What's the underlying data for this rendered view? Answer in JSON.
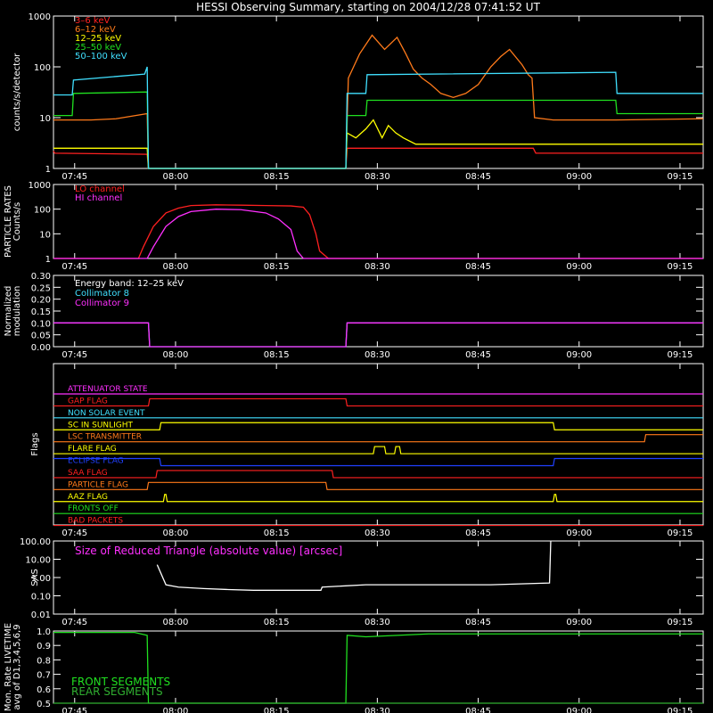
{
  "title": "HESSI Observing Summary, starting on 2004/12/28 07:41:52 UT",
  "x_ticks": [
    "07:45",
    "08:00",
    "08:15",
    "08:30",
    "08:45",
    "09:00",
    "09:15"
  ],
  "colors": {
    "red": "#ff2020",
    "orange": "#ff7a1a",
    "yellow": "#ffff00",
    "green": "#20e020",
    "cyan": "#40e0ff",
    "magenta": "#ff30ff",
    "crimson": "#e01040",
    "blue": "#2040ff",
    "white": "#ffffff",
    "darkgreen": "#30b030"
  },
  "chart_data": [
    {
      "id": "lightcurves",
      "type": "line",
      "title": "HESSI Observing Summary, starting on 2004/12/28 07:41:52 UT",
      "ylabel": "counts/s/detector",
      "yscale": "log",
      "ylim": [
        1,
        1000
      ],
      "y_ticks": [
        "1",
        "10",
        "100",
        "1000"
      ],
      "x_range_minutes": [
        0,
        52
      ],
      "series": [
        {
          "name": "3–6 keV",
          "color": "red",
          "x": [
            0,
            0.1,
            7.5,
            7.6,
            23.4,
            23.5,
            38.4,
            38.6,
            52
          ],
          "y": [
            2.2,
            2.0,
            1.9,
            1.0,
            1.0,
            2.5,
            2.5,
            2.0,
            2.0
          ]
        },
        {
          "name": "6–12 keV",
          "color": "orange",
          "x": [
            0,
            1.2,
            3,
            5,
            7.5,
            7.6,
            23.4,
            23.6,
            24.5,
            25.5,
            26.5,
            27.5,
            28.2,
            28.8,
            29.5,
            30.2,
            31,
            32,
            33,
            34,
            35,
            35.8,
            36.5,
            37.5,
            38,
            38.3,
            38.5,
            40,
            45,
            52
          ],
          "y": [
            9,
            9,
            9,
            9.5,
            12,
            1.0,
            1.0,
            60,
            180,
            420,
            220,
            380,
            180,
            90,
            60,
            45,
            30,
            25,
            30,
            45,
            100,
            160,
            220,
            110,
            70,
            60,
            10,
            9,
            9,
            9.5
          ]
        },
        {
          "name": "12–25 keV",
          "color": "yellow",
          "x": [
            0,
            7.5,
            7.6,
            23.4,
            23.5,
            24.2,
            25,
            25.6,
            26.3,
            26.8,
            27.4,
            28,
            29,
            52
          ],
          "y": [
            2.5,
            2.5,
            1.0,
            1.0,
            5,
            4,
            6,
            9,
            4,
            7,
            5,
            4,
            3,
            3
          ]
        },
        {
          "name": "25–50 keV",
          "color": "green",
          "x": [
            0,
            1.5,
            1.6,
            7.5,
            7.6,
            23.4,
            23.5,
            25,
            25.1,
            45,
            45.1,
            52
          ],
          "y": [
            11,
            11,
            30,
            32,
            1.0,
            1.0,
            11,
            11,
            22,
            22,
            12,
            12
          ]
        },
        {
          "name": "50–100 keV",
          "color": "cyan",
          "x": [
            0,
            1.5,
            1.6,
            7.3,
            7.5,
            7.6,
            23.4,
            23.5,
            25,
            25.1,
            45,
            45.1,
            52
          ],
          "y": [
            28,
            28,
            55,
            72,
            100,
            1.0,
            1.0,
            30,
            30,
            70,
            78,
            30,
            30
          ]
        }
      ]
    },
    {
      "id": "particle",
      "type": "line",
      "ylabel": "PARTICLE RATES\nCounts/s",
      "yscale": "log",
      "ylim": [
        1,
        1000
      ],
      "y_ticks": [
        "1",
        "10",
        "100",
        "1000"
      ],
      "x_range_minutes": [
        0,
        52
      ],
      "series": [
        {
          "name": "LO channel",
          "color": "red",
          "x": [
            0,
            6.8,
            7.2,
            8,
            9,
            10,
            11,
            13,
            15,
            17,
            19,
            20,
            20.5,
            21,
            21.3,
            22,
            52
          ],
          "y": [
            1.0,
            1.0,
            3,
            20,
            70,
            110,
            140,
            150,
            145,
            140,
            135,
            120,
            60,
            10,
            2,
            1.0,
            1.0
          ]
        },
        {
          "name": "HI channel",
          "color": "magenta",
          "x": [
            0,
            7.5,
            8,
            9,
            10,
            11,
            13,
            15,
            17,
            18,
            19,
            19.5,
            20,
            52
          ],
          "y": [
            1.0,
            1.0,
            3,
            20,
            50,
            80,
            100,
            95,
            70,
            40,
            15,
            2,
            1.0,
            1.0
          ]
        }
      ]
    },
    {
      "id": "modulation",
      "type": "line",
      "ylabel": "Normalized\nmodulation",
      "ylim": [
        0,
        0.3
      ],
      "y_ticks": [
        "0.00",
        "0.05",
        "0.10",
        "0.15",
        "0.20",
        "0.25",
        "0.30"
      ],
      "x_range_minutes": [
        0,
        52
      ],
      "annotation": "Energy band: 12–25 keV",
      "series": [
        {
          "name": "Collimator 8",
          "color": "cyan",
          "x": [
            0,
            7.6,
            7.7,
            23.4,
            23.5,
            52
          ],
          "y": [
            0.1,
            0.1,
            0,
            0,
            0.1,
            0.1
          ]
        },
        {
          "name": "Collimator 9",
          "color": "magenta",
          "x": [
            0,
            7.6,
            7.7,
            23.4,
            23.5,
            52
          ],
          "y": [
            0.1,
            0.1,
            0,
            0,
            0.1,
            0.1
          ]
        }
      ]
    },
    {
      "id": "flags",
      "type": "line",
      "ylabel": "Flags",
      "x_range_minutes": [
        0,
        52
      ],
      "series": [
        {
          "name": "ATTENUATOR STATE",
          "color": "magenta",
          "x": [
            0,
            52
          ],
          "y": [
            0,
            0
          ]
        },
        {
          "name": "GAP FLAG",
          "color": "red",
          "x": [
            0,
            7.6,
            7.7,
            23.4,
            23.5,
            52
          ],
          "y": [
            0,
            0,
            1,
            1,
            0,
            0
          ]
        },
        {
          "name": "NON SOLAR EVENT",
          "color": "cyan",
          "x": [
            0,
            52
          ],
          "y": [
            0,
            0
          ]
        },
        {
          "name": "SC IN SUNLIGHT",
          "color": "yellow",
          "x": [
            0,
            8.5,
            8.6,
            40,
            40.1,
            52
          ],
          "y": [
            0,
            0,
            1,
            1,
            0,
            0
          ]
        },
        {
          "name": "LSC TRANSMITTER",
          "color": "orange",
          "x": [
            0,
            47.3,
            47.4,
            52
          ],
          "y": [
            0,
            0,
            1,
            1
          ]
        },
        {
          "name": "FLARE FLAG",
          "color": "yellow",
          "x": [
            0,
            25.6,
            25.7,
            26.5,
            26.6,
            27.3,
            27.4,
            27.7,
            27.8,
            52
          ],
          "y": [
            0,
            0,
            1,
            1,
            0,
            0,
            1,
            1,
            0,
            0
          ]
        },
        {
          "name": "ECLIPSE FLAG",
          "color": "blue",
          "x": [
            0,
            8.5,
            8.6,
            40,
            40.1,
            52
          ],
          "y": [
            1,
            1,
            0,
            0,
            1,
            1
          ]
        },
        {
          "name": "SAA FLAG",
          "color": "red",
          "x": [
            0,
            8.2,
            8.3,
            22.3,
            22.4,
            52
          ],
          "y": [
            0,
            0,
            1,
            1,
            0,
            0
          ]
        },
        {
          "name": "PARTICLE FLAG",
          "color": "orange",
          "x": [
            0,
            7.5,
            7.6,
            21.8,
            21.9,
            52
          ],
          "y": [
            0,
            0,
            1,
            1,
            0,
            0
          ]
        },
        {
          "name": "AAZ FLAG",
          "color": "yellow",
          "x": [
            0,
            8.8,
            8.9,
            9.0,
            9.1,
            40.0,
            40.1,
            40.2,
            40.3,
            52
          ],
          "y": [
            0,
            0,
            1,
            1,
            0,
            0,
            1,
            1,
            0,
            0
          ]
        },
        {
          "name": "FRONTS OFF",
          "color": "green",
          "x": [
            0,
            52
          ],
          "y": [
            0,
            0
          ]
        },
        {
          "name": "BAD PACKETS",
          "color": "red",
          "x": [
            0,
            52
          ],
          "y": [
            0,
            0
          ]
        }
      ]
    },
    {
      "id": "sas",
      "type": "line",
      "ylabel": "SAS",
      "yscale": "log",
      "ylim": [
        0.01,
        100
      ],
      "y_ticks": [
        "0.01",
        "0.10",
        "1.00",
        "10.00",
        "100.00"
      ],
      "x_range_minutes": [
        0,
        52
      ],
      "annotation": "Size of Reduced Triangle (absolute value) [arcsec]",
      "series": [
        {
          "name": "Size of Reduced Triangle (absolute value) [arcsec]",
          "color": "white",
          "x": [
            8.3,
            9,
            10,
            12,
            14,
            16,
            18,
            20,
            21.4,
            21.5,
            25,
            30,
            35,
            39.7,
            39.8
          ],
          "y": [
            5,
            0.4,
            0.3,
            0.25,
            0.22,
            0.2,
            0.2,
            0.2,
            0.2,
            0.3,
            0.4,
            0.4,
            0.4,
            0.5,
            100
          ]
        }
      ]
    },
    {
      "id": "livetime",
      "type": "line",
      "ylabel": "Mon. Rate LIVETIME\navg of D1,3,4,5,6,9",
      "ylim": [
        0.5,
        1.0
      ],
      "y_ticks": [
        "0.5",
        "0.6",
        "0.7",
        "0.8",
        "0.9",
        "1.0"
      ],
      "x_range_minutes": [
        0,
        52
      ],
      "series": [
        {
          "name": "FRONT SEGMENTS",
          "color": "green",
          "x": [
            0,
            6.5,
            7.5,
            7.6,
            23.4,
            23.5,
            25,
            30,
            52
          ],
          "y": [
            0.99,
            0.99,
            0.97,
            0.5,
            0.5,
            0.97,
            0.96,
            0.98,
            0.98
          ]
        },
        {
          "name": "REAR SEGMENTS",
          "color": "darkgreen",
          "x": [
            0,
            52
          ],
          "y": [
            0.5,
            0.5
          ]
        }
      ]
    }
  ]
}
